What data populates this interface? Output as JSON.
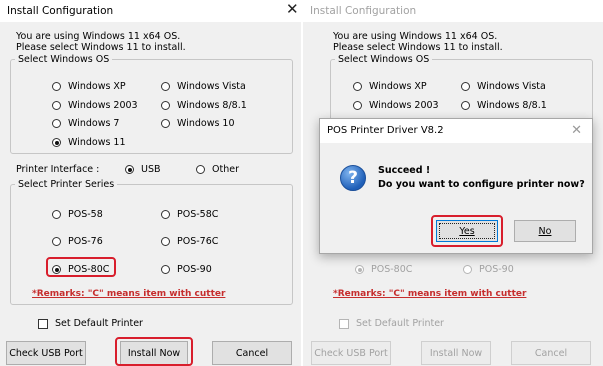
{
  "left": {
    "title": "Install Configuration",
    "close_glyph": "✕",
    "info_line1": "You are using Windows 11 x64 OS.",
    "info_line2": "Please select Windows 11 to install.",
    "os_group_label": "Select Windows OS",
    "os_options": [
      "Windows XP",
      "Windows Vista",
      "Windows 2003",
      "Windows 8/8.1",
      "Windows 7",
      "Windows 10",
      "Windows 11"
    ],
    "os_selected": "Windows 11",
    "interface_label": "Printer Interface :",
    "interface_options": [
      "USB",
      "Other"
    ],
    "interface_selected": "USB",
    "series_group_label": "Select Printer Series",
    "series_options": [
      "POS-58",
      "POS-58C",
      "POS-76",
      "POS-76C",
      "POS-80C",
      "POS-90"
    ],
    "series_selected": "POS-80C",
    "remark": "*Remarks: \"C\" means item with cutter",
    "default_printer_label": "Set Default Printer",
    "default_printer_checked": false,
    "buttons": {
      "check_usb": "Check USB Port",
      "install": "Install Now",
      "cancel": "Cancel"
    }
  },
  "right": {
    "title": "Install Configuration",
    "info_line1": "You are using Windows 11 x64 OS.",
    "info_line2": "Please select Windows 11 to install.",
    "os_group_label": "Select Windows OS",
    "os_options": [
      "Windows XP",
      "Windows Vista",
      "Windows 2003",
      "Windows 8/8.1"
    ],
    "series_options": [
      "POS-80C",
      "POS-90"
    ],
    "remark": "*Remarks: \"C\" means item with cutter",
    "default_printer_label": "Set Default Printer",
    "buttons": {
      "check_usb": "Check USB Port",
      "install": "Install Now",
      "cancel": "Cancel"
    }
  },
  "dialog": {
    "title": "POS Printer Driver V8.2",
    "close_glyph": "✕",
    "icon": "question-icon",
    "icon_glyph": "?",
    "message_line1": "Succeed !",
    "message_line2": "Do you want to configure printer now?",
    "yes_label": "Yes",
    "no_label": "No"
  },
  "colors": {
    "highlight": "#d81e2c",
    "remark": "#c62d2d",
    "window_bg": "#f0f0f0",
    "focus": "#0078d7"
  }
}
